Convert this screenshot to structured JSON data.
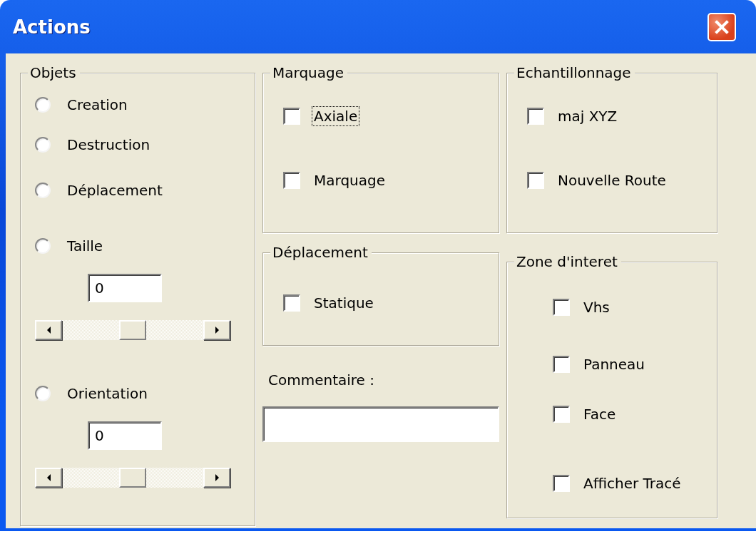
{
  "window": {
    "title": "Actions"
  },
  "columns": [
    [
      {
        "title": "Objets",
        "items": [
          {
            "kind": "radio",
            "label": "Creation",
            "selected": false
          },
          {
            "kind": "radio",
            "label": "Destruction",
            "selected": false
          },
          {
            "kind": "radio",
            "label": "Déplacement",
            "selected": false
          },
          {
            "kind": "radio",
            "label": "Taille",
            "selected": false
          },
          {
            "kind": "field",
            "value": "0"
          },
          {
            "kind": "scrollbar"
          },
          {
            "kind": "radio",
            "label": "Orientation",
            "selected": false
          },
          {
            "kind": "field",
            "value": "0"
          },
          {
            "kind": "scrollbar"
          }
        ]
      }
    ],
    [
      {
        "title": "Marquage",
        "items": [
          {
            "kind": "checkbox",
            "label": "Axiale",
            "checked": false,
            "focused": true
          },
          {
            "kind": "checkbox",
            "label": "Marquage",
            "checked": false,
            "focused": false
          }
        ]
      },
      {
        "title": "Déplacement",
        "items": [
          {
            "kind": "checkbox",
            "label": "Statique",
            "checked": false,
            "focused": false
          }
        ]
      },
      {
        "kind": "comment",
        "label": "Commentaire :"
      }
    ],
    [
      {
        "title": "Echantillonnage",
        "items": [
          {
            "kind": "checkbox",
            "label": "maj XYZ",
            "checked": false,
            "focused": false
          },
          {
            "kind": "checkbox",
            "label": "Nouvelle Route",
            "checked": false,
            "focused": false
          }
        ]
      },
      {
        "title": "Zone d'interet",
        "items": [
          {
            "kind": "checkbox",
            "label": "Vhs",
            "checked": false,
            "focused": false
          },
          {
            "kind": "checkbox",
            "label": "Panneau",
            "checked": false,
            "focused": false
          },
          {
            "kind": "checkbox",
            "label": "Face",
            "checked": false,
            "focused": false
          },
          {
            "kind": "checkbox",
            "label": "Afficher Tracé",
            "checked": false,
            "focused": false
          }
        ]
      }
    ]
  ]
}
